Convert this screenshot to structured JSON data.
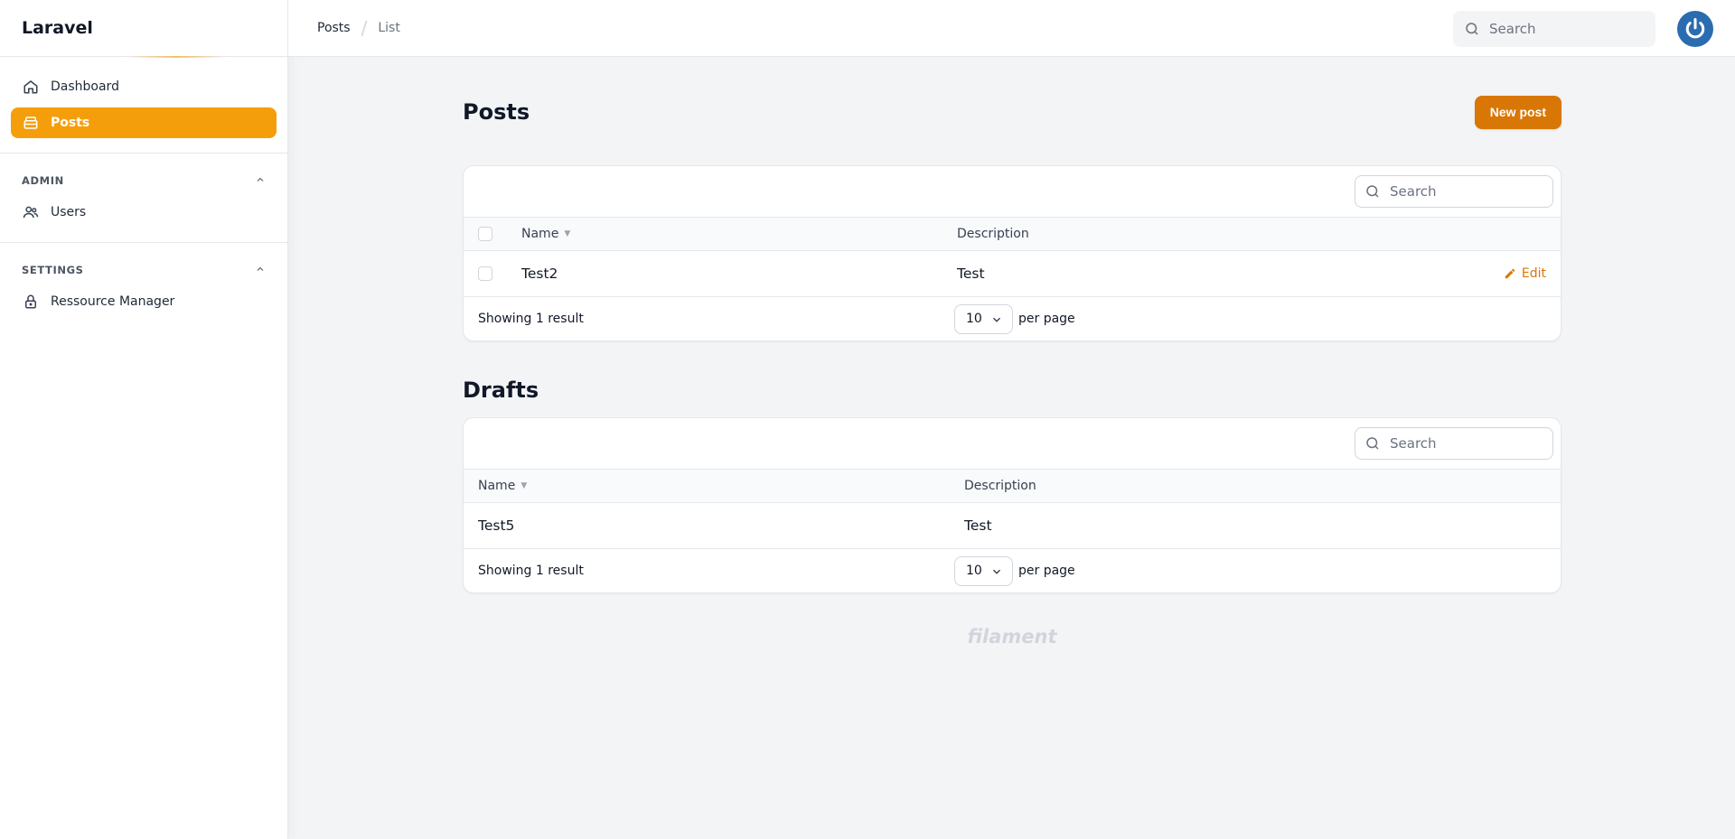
{
  "app": {
    "brand": "Laravel"
  },
  "sidebar": {
    "items": [
      {
        "label": "Dashboard",
        "icon": "home-icon",
        "active": false
      },
      {
        "label": "Posts",
        "icon": "archive-icon",
        "active": true
      }
    ],
    "groups": [
      {
        "label": "ADMIN",
        "items": [
          {
            "label": "Users",
            "icon": "users-icon"
          }
        ]
      },
      {
        "label": "SETTINGS",
        "items": [
          {
            "label": "Ressource Manager",
            "icon": "lock-icon"
          }
        ]
      }
    ]
  },
  "topbar": {
    "breadcrumb": [
      "Posts",
      "List"
    ],
    "search_placeholder": "Search"
  },
  "posts": {
    "title": "Posts",
    "new_button": "New post",
    "search_placeholder": "Search",
    "columns": [
      "Name",
      "Description"
    ],
    "rows": [
      {
        "name": "Test2",
        "description": "Test",
        "action": "Edit"
      }
    ],
    "footer": {
      "summary": "Showing 1 result",
      "per_page_value": "10",
      "per_page_label": "per page"
    }
  },
  "drafts": {
    "title": "Drafts",
    "search_placeholder": "Search",
    "columns": [
      "Name",
      "Description"
    ],
    "rows": [
      {
        "name": "Test5",
        "description": "Test"
      }
    ],
    "footer": {
      "summary": "Showing 1 result",
      "per_page_value": "10",
      "per_page_label": "per page"
    }
  },
  "footer": {
    "brand": "filament"
  },
  "colors": {
    "accent": "#f59e0b",
    "primary_button": "#d97706",
    "avatar": "#2b6cb0",
    "background": "#f3f4f6"
  }
}
